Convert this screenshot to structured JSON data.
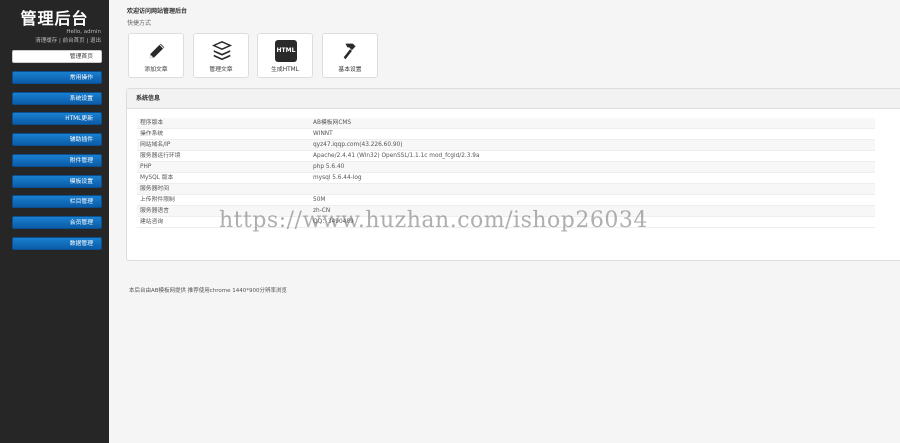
{
  "sidebar": {
    "logo": "管理后台",
    "hello": "Hello, admin",
    "user_links": [
      "清理缓存",
      "前台首页",
      "退出"
    ],
    "user_sep": " | ",
    "items": [
      {
        "label": "管理首页",
        "active": true
      },
      {
        "label": "常用操作"
      },
      {
        "label": "系统设置"
      },
      {
        "label": "HTML更新"
      },
      {
        "label": "辅助插件"
      },
      {
        "label": "附件管理"
      },
      {
        "label": "模板设置"
      },
      {
        "label": "栏目管理"
      },
      {
        "label": "会员管理"
      },
      {
        "label": "数据管理"
      }
    ]
  },
  "main": {
    "welcome": "欢迎访问网站管理后台",
    "quick_label": "快捷方式",
    "quick": [
      {
        "label": "添加文章",
        "icon": "pencil-icon"
      },
      {
        "label": "管理文章",
        "icon": "stack-icon"
      },
      {
        "label": "生成HTML",
        "icon": "html-icon",
        "badge": "HTML"
      },
      {
        "label": "基本设置",
        "icon": "hammer-icon"
      }
    ],
    "panel_title": "系统信息",
    "sysinfo": [
      {
        "k": "程序版本",
        "v": "AB模板网CMS"
      },
      {
        "k": "操作系统",
        "v": "WINNT"
      },
      {
        "k": "网站域名/IP",
        "v": "qyz47.iqqp.com(43.226.60.90)"
      },
      {
        "k": "服务器运行环境",
        "v": "Apache/2.4.41 (Win32) OpenSSL/1.1.1c mod_fcgid/2.3.9a"
      },
      {
        "k": "PHP",
        "v": "php 5.6.40"
      },
      {
        "k": "MySQL 版本",
        "v": "mysql 5.6.44-log"
      },
      {
        "k": "服务器时间",
        "v": ""
      },
      {
        "k": "上传附件限制",
        "v": "50M"
      },
      {
        "k": "服务器语言",
        "v": "zh-CN"
      },
      {
        "k": "建站咨询",
        "v": "QQ：3490489"
      }
    ],
    "footer": "本后台由AB模板网提供 推荐使用chrome 1440*900分辨率浏览"
  },
  "watermark": "https://www.huzhan.com/ishop26034",
  "colors": {
    "sidebar_bg": "#262626",
    "nav_blue": "#1a7fcf",
    "main_bg": "#f5f5f5"
  }
}
